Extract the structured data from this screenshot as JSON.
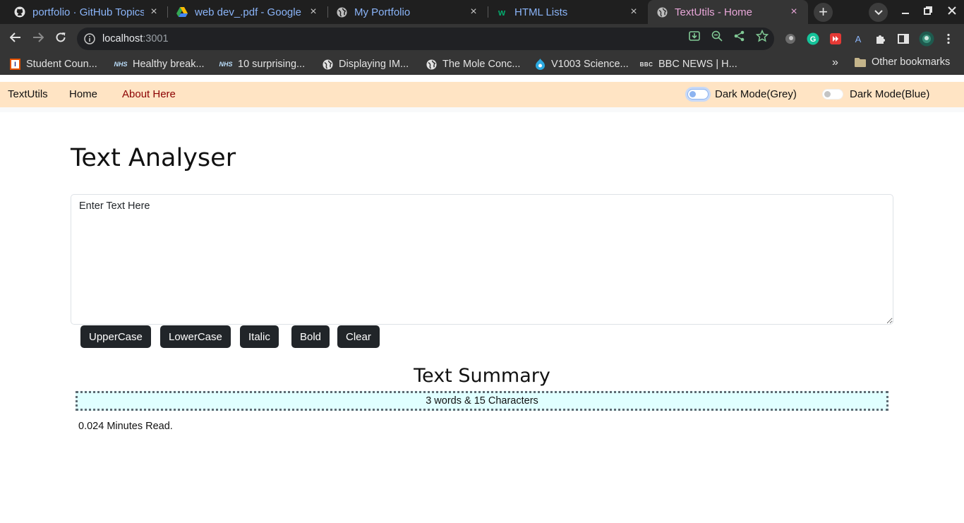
{
  "browser": {
    "tabs": [
      {
        "title": "portfolio · GitHub Topics",
        "icon": "github-icon",
        "active": false
      },
      {
        "title": "web dev_.pdf - Google Drive",
        "icon": "google-drive-icon",
        "active": false
      },
      {
        "title": "My Portfolio",
        "icon": "globe-icon",
        "active": false
      },
      {
        "title": "HTML Lists",
        "icon": "w3schools-icon",
        "active": false
      },
      {
        "title": "TextUtils - Home",
        "icon": "globe-icon",
        "active": true
      }
    ],
    "new_tab_label": "+",
    "url_host": "localhost",
    "url_port": ":3001",
    "bookmarks": [
      {
        "label": "Student Coun...",
        "icon": "student-council-icon"
      },
      {
        "label": "Healthy break...",
        "icon": "nhs-icon"
      },
      {
        "label": "10 surprising...",
        "icon": "nhs-icon"
      },
      {
        "label": "Displaying IM...",
        "icon": "globe-icon"
      },
      {
        "label": "The Mole Conc...",
        "icon": "globe-icon"
      },
      {
        "label": "V1003 Science...",
        "icon": "drupal-icon"
      },
      {
        "label": "BBC NEWS | H...",
        "icon": "bbc-icon"
      }
    ],
    "more_bookmarks": "»",
    "other_bookmarks": "Other bookmarks",
    "accent_color": "#8ab4f8",
    "active_tab_color": "#e8a6d8"
  },
  "app": {
    "navbar": {
      "brand": "TextUtils",
      "home": "Home",
      "about": "About Here",
      "toggle_grey_label": "Dark Mode(Grey)",
      "toggle_blue_label": "Dark Mode(Blue)",
      "background": "#ffe4c4"
    },
    "title": "Text Analyser",
    "textarea_value": "Enter Text Here",
    "buttons": {
      "uppercase": "UpperCase",
      "lowercase": "LowerCase",
      "italic": "Italic",
      "bold": "Bold",
      "clear": "Clear"
    },
    "summary_title": "Text Summary",
    "summary_text": "3 words & 15 Characters",
    "read_time": "0.024 Minutes Read."
  }
}
